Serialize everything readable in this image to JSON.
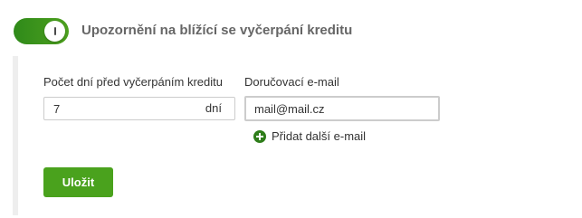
{
  "toggle": {
    "state": "on",
    "accent_color": "#4aa21d"
  },
  "section": {
    "title": "Upozornění na blížící se vyčerpání kreditu"
  },
  "days_field": {
    "label": "Počet dní před vyčerpáním kreditu",
    "value": "7",
    "unit": "dní"
  },
  "email_field": {
    "label": "Doručovací e-mail",
    "value": "mail@mail.cz"
  },
  "add_email": {
    "icon": "plus-circle-icon",
    "label": "Přidat další e-mail"
  },
  "save_button": {
    "label": "Uložit"
  }
}
